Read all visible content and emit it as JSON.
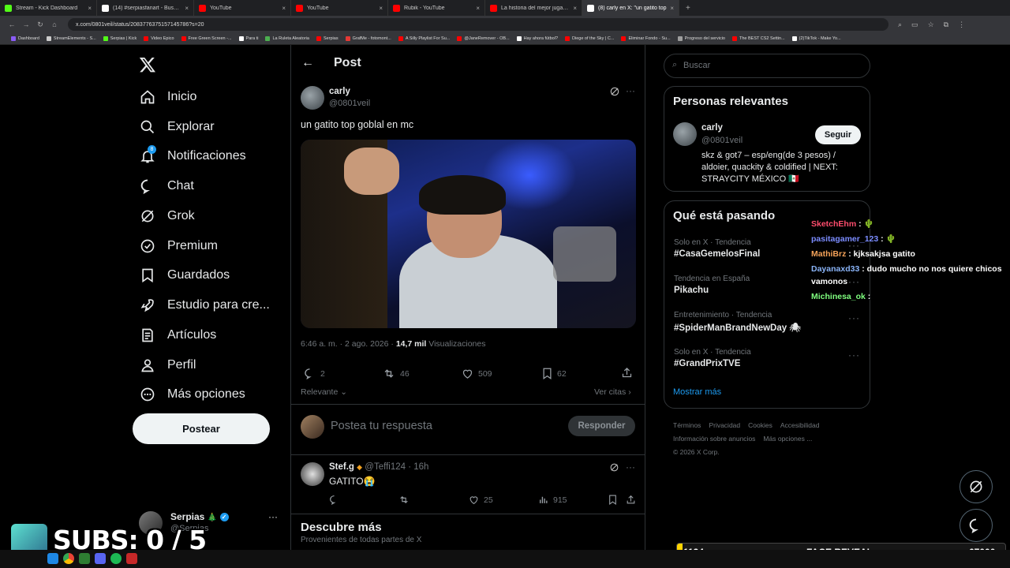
{
  "browser": {
    "tabs": [
      {
        "title": "Stream - Kick Dashboard",
        "color": "#53fc18"
      },
      {
        "title": "(14) #serpiasfanart - Buscar / X",
        "color": "#ffffff"
      },
      {
        "title": "YouTube",
        "color": "#ff0000"
      },
      {
        "title": "YouTube",
        "color": "#ff0000"
      },
      {
        "title": "Rubik - YouTube",
        "color": "#ff0000"
      },
      {
        "title": "La historia del mejor jugador de",
        "color": "#ff0000"
      },
      {
        "title": "(8) carly en X: \"un gatito top",
        "color": "#ffffff"
      }
    ],
    "url": "x.com/0801veil/status/2083776375157145786?s=20",
    "bookmarks": [
      {
        "label": "Dashboard",
        "color": "#8a5cf6"
      },
      {
        "label": "StreamElements - S...",
        "color": "#cccccc"
      },
      {
        "label": "Serpias | Kick",
        "color": "#53fc18"
      },
      {
        "label": "Video Epico",
        "color": "#ff0000"
      },
      {
        "label": "Free Green Screen -...",
        "color": "#ff0000"
      },
      {
        "label": "Para ti",
        "color": "#ffffff"
      },
      {
        "label": "La Ruleta Aleatoria",
        "color": "#4caf50"
      },
      {
        "label": "Serpias",
        "color": "#ff0000"
      },
      {
        "label": "GrafMe - fotomont...",
        "color": "#e53935"
      },
      {
        "label": "A Silly Playlist For Su...",
        "color": "#ff0000"
      },
      {
        "label": "@JaneRemover - OB...",
        "color": "#ff0000"
      },
      {
        "label": "Hay ahora fútbol?",
        "color": "#ffffff"
      },
      {
        "label": "Diege of the Sky | C...",
        "color": "#ff0000"
      },
      {
        "label": "Eliminar Fondo - Su...",
        "color": "#ff0000"
      },
      {
        "label": "Progreso del servicio",
        "color": "#9e9e9e"
      },
      {
        "label": "The BEST CS2 Settin...",
        "color": "#ff0000"
      },
      {
        "label": "(2)TikTok - Make Yo...",
        "color": "#ffffff"
      }
    ]
  },
  "sidebar": {
    "items": [
      {
        "label": "Inicio",
        "icon": "home-icon"
      },
      {
        "label": "Explorar",
        "icon": "search-icon"
      },
      {
        "label": "Notificaciones",
        "icon": "bell-icon",
        "badge": "8"
      },
      {
        "label": "Chat",
        "icon": "chat-icon"
      },
      {
        "label": "Grok",
        "icon": "grok-icon"
      },
      {
        "label": "Premium",
        "icon": "verified-icon"
      },
      {
        "label": "Guardados",
        "icon": "bookmark-icon"
      },
      {
        "label": "Estudio para cre...",
        "icon": "rocket-icon"
      },
      {
        "label": "Artículos",
        "icon": "article-icon"
      },
      {
        "label": "Perfil",
        "icon": "person-icon"
      },
      {
        "label": "Más opciones",
        "icon": "more-icon"
      }
    ],
    "post_button": "Postear",
    "account": {
      "name": "Serpias",
      "handle": "@Serpias",
      "emoji": "🎄"
    }
  },
  "header": {
    "title": "Post"
  },
  "tweet": {
    "author_name": "carly",
    "author_handle": "@0801veil",
    "text": "un gatito top goblal en mc",
    "timestamp": "6:46 a. m. · 2 ago. 2026 ·",
    "views_count": "14,7 mil",
    "views_label": "Visualizaciones",
    "replies": "2",
    "retweets": "46",
    "likes": "509",
    "bookmarks": "62",
    "sort_label": "Relevante",
    "quotes_label": "Ver citas"
  },
  "reply_box": {
    "placeholder": "Postea tu respuesta",
    "button": "Responder"
  },
  "reply": {
    "name": "Stef.g",
    "handle": "@Teffi124",
    "time": "· 16h",
    "text": "GATITO😭",
    "likes": "25",
    "views": "915"
  },
  "discover": {
    "title": "Descubre más",
    "subtitle": "Provenientes de todas partes de X"
  },
  "right": {
    "search_placeholder": "Buscar",
    "relevant_title": "Personas relevantes",
    "person": {
      "name": "carly",
      "handle": "@0801veil",
      "bio": "skz & got7 – esp/eng(de 3 pesos) / aldoier, quackity & coldified | NEXT: STRAYCITY MÉXICO 🇲🇽",
      "follow": "Seguir"
    },
    "trends_title": "Qué está pasando",
    "trends": [
      {
        "context": "Solo en X · Tendencia",
        "name": "#CasaGemelosFinal"
      },
      {
        "context": "Tendencia en España",
        "name": "Pikachu"
      },
      {
        "context": "Entretenimiento · Tendencia",
        "name": "#SpiderManBrandNewDay 🕷"
      },
      {
        "context": "Solo en X · Tendencia",
        "name": "#GrandPrixTVE"
      }
    ],
    "show_more": "Mostrar más",
    "footer": [
      "Términos",
      "Privacidad",
      "Cookies",
      "Accesibilidad",
      "Información sobre anuncios",
      "Más opciones ...",
      "© 2026 X Corp."
    ]
  },
  "overlay": {
    "chat": [
      {
        "user": "SketchEhm",
        "msg": ": 🌵",
        "color": "#ff4d6d"
      },
      {
        "user": "pasitagamer_123",
        "msg": ": 🌵",
        "color": "#7b8cff"
      },
      {
        "user": "MathiBrz",
        "msg": ": kjksakjsa gatito",
        "color": "#f4a259"
      },
      {
        "user": "Dayanaxd33",
        "msg": ": dudo mucho no nos quiere chicos",
        "color": "#8ab4f8"
      },
      {
        "user": "",
        "msg": "vamonos",
        "color": "#ffffff"
      },
      {
        "user": "Michinesa_ok",
        "msg": ":",
        "color": "#7fff7f"
      }
    ],
    "subs": "SUBS: 0 / 5",
    "goal_left": "1134",
    "goal_title": "FACE REVEAL",
    "goal_right": "67000"
  }
}
